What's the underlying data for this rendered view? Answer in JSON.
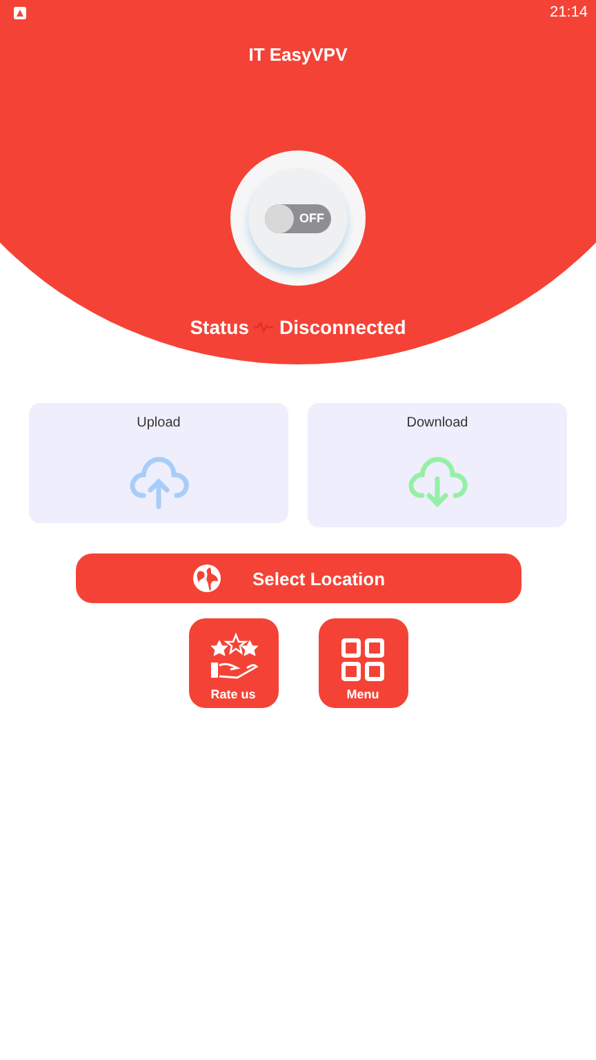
{
  "status_bar": {
    "time": "21:14"
  },
  "app_title": "IT EasyVPV",
  "connect_switch": {
    "label": "OFF",
    "on": false
  },
  "status": {
    "label": "Status",
    "value": "Disconnected"
  },
  "stats": [
    {
      "kind": "upload",
      "label": "Upload"
    },
    {
      "kind": "download",
      "label": "Download"
    }
  ],
  "location_button": "Select Location",
  "actions": [
    {
      "kind": "rate",
      "label": "Rate us"
    },
    {
      "kind": "menu",
      "label": "Menu"
    }
  ]
}
